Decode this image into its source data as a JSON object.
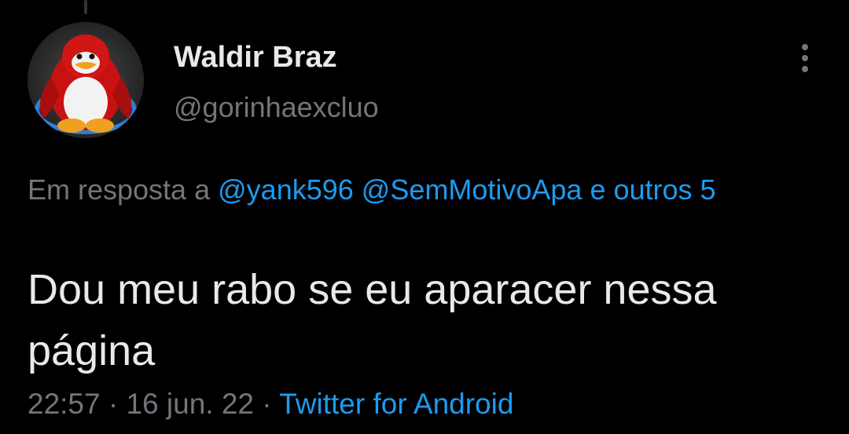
{
  "tweet": {
    "author": {
      "display_name": "Waldir Braz",
      "handle": "@gorinhaexcluo",
      "avatar_icon": "red-penguin-avatar-icon"
    },
    "more_icon": "more-vertical-icon",
    "reply_context": {
      "prefix": "Em resposta a",
      "mentions": [
        "@yank596",
        "@SemMotivoApa"
      ],
      "others": "e outros 5"
    },
    "text": "Dou meu rabo se eu aparacer nessa página",
    "time": "22:57",
    "separator": "·",
    "date": "16 jun. 22",
    "source": "Twitter for Android"
  },
  "colors": {
    "background": "#000000",
    "primary_text": "#e7e9ea",
    "secondary_text": "#71767b",
    "link": "#1d9bf0"
  }
}
